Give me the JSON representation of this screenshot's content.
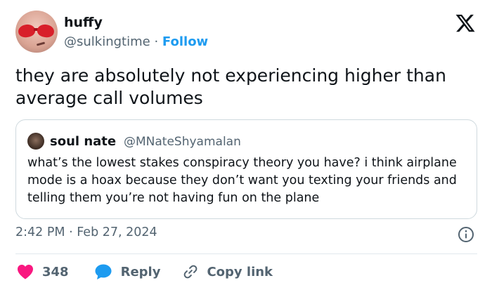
{
  "author": {
    "display_name": "huffy",
    "handle": "@sulkingtime",
    "separator": "·",
    "follow_label": "Follow"
  },
  "tweet": {
    "text": "they are absolutely not experiencing higher than average call volumes",
    "timestamp": "2:42 PM · Feb 27, 2024"
  },
  "quoted_tweet": {
    "display_name": "soul nate",
    "handle": "@MNateShyamalan",
    "text": "what’s the lowest stakes conspiracy theory you have? i think airplane mode is a hoax because they don’t want you texting your friends and telling them you’re not having fun on the plane"
  },
  "actions": {
    "like_count": "348",
    "reply_label": "Reply",
    "copy_link_label": "Copy link"
  },
  "colors": {
    "text_primary": "#0f1419",
    "text_secondary": "#536471",
    "link_blue": "#1d9bf0",
    "heart_pink": "#f91880",
    "border": "#cfd9de"
  },
  "icons": [
    "x-logo-icon",
    "info-icon",
    "heart-icon",
    "reply-bubble-icon",
    "link-icon"
  ]
}
